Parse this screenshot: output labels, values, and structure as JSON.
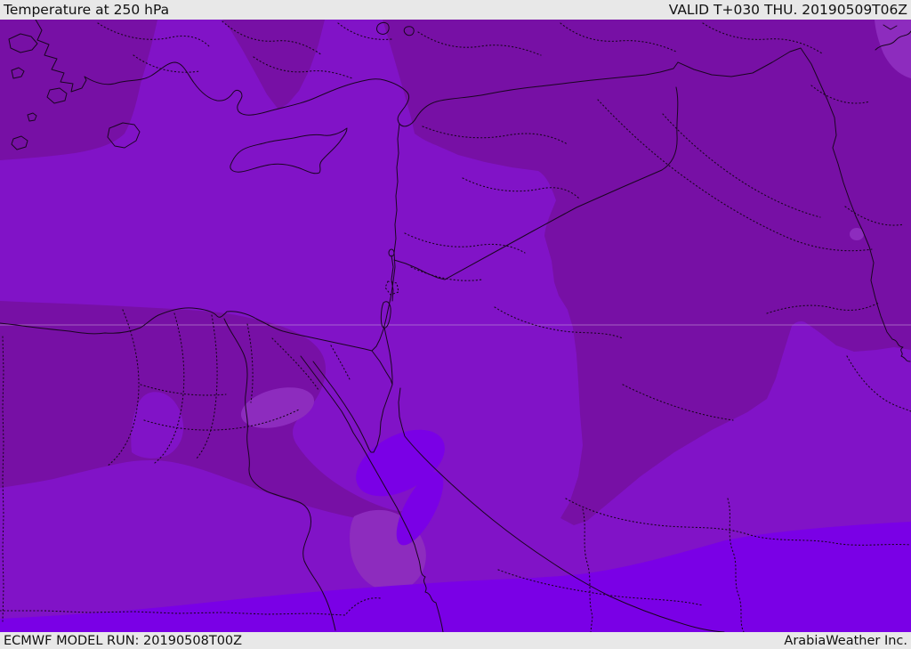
{
  "header": {
    "title": "Temperature at 250 hPa",
    "valid_time": "VALID T+030 THU. 20190509T06Z"
  },
  "footer": {
    "model_run": "ECMWF MODEL RUN: 20190508T00Z",
    "credit": "ArabiaWeather Inc."
  },
  "map": {
    "parameter": "Temperature",
    "level": "250 hPa",
    "colors": {
      "bar_background": "#E8E8E8",
      "bar_text": "#111111",
      "shade_medium": "#8113C7",
      "shade_dark": "#7710A5",
      "shade_light": "#8D2CBE",
      "shade_bright": "#7A00E6",
      "line": "#1A0520",
      "grid": "#C9A3D9"
    }
  }
}
